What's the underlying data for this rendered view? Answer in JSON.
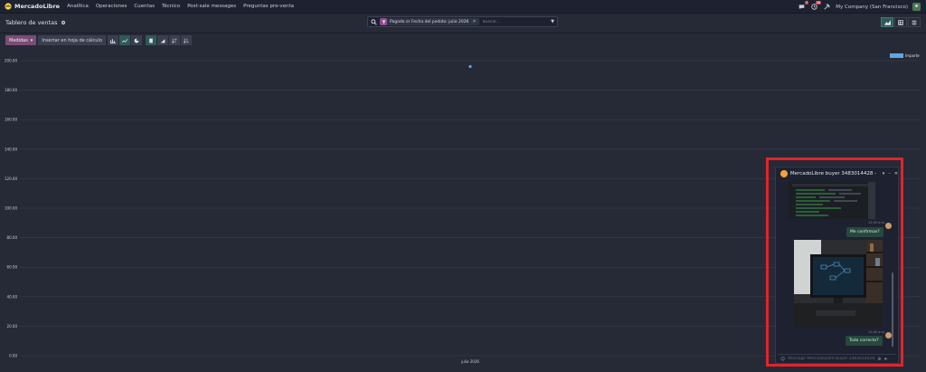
{
  "navbar": {
    "brand": "MercadoLibre",
    "menu": [
      "Analítica",
      "Operaciones",
      "Cuentas",
      "Técnico",
      "Post-sale messages",
      "Preguntas pre-venta"
    ],
    "messages_badge": "7",
    "activity_badge": "28",
    "company": "My Company (San Francisco)"
  },
  "control": {
    "title": "Tablero de ventas",
    "facet": "Pagado  or  Fecha del pedido: julio 2026",
    "search_placeholder": "Buscar..."
  },
  "toolbar": {
    "measures": "Medidas",
    "insert": "Insertar en hoja de cálculo"
  },
  "chart_data": {
    "type": "line",
    "categories": [
      "julio 2026"
    ],
    "series": [
      {
        "name": "Importe",
        "values": [
          196
        ]
      }
    ],
    "ylim": [
      0,
      200
    ],
    "yticks": [
      "0.00",
      "20.00",
      "40.00",
      "60.00",
      "80.00",
      "100.00",
      "120.00",
      "140.00",
      "160.00",
      "180.00",
      "200.00"
    ],
    "grid": true,
    "legend": "top-right",
    "color": "#5fa6e2"
  },
  "chat": {
    "title": "MercadoLibre buyer 3483014428 - 2...",
    "messages": [
      {
        "time": "12:45 a.m.",
        "text": "Me confirmas?"
      },
      {
        "time": "12:45 a.m.",
        "text": "Todo correcto?"
      }
    ],
    "composer_placeholder": "Message MercadoLibre buyer 3483014428..."
  },
  "colors": {
    "background": "#262a36",
    "navbar": "#1e2230",
    "accent": "#7a4c76",
    "highlight": "#e0252b"
  }
}
